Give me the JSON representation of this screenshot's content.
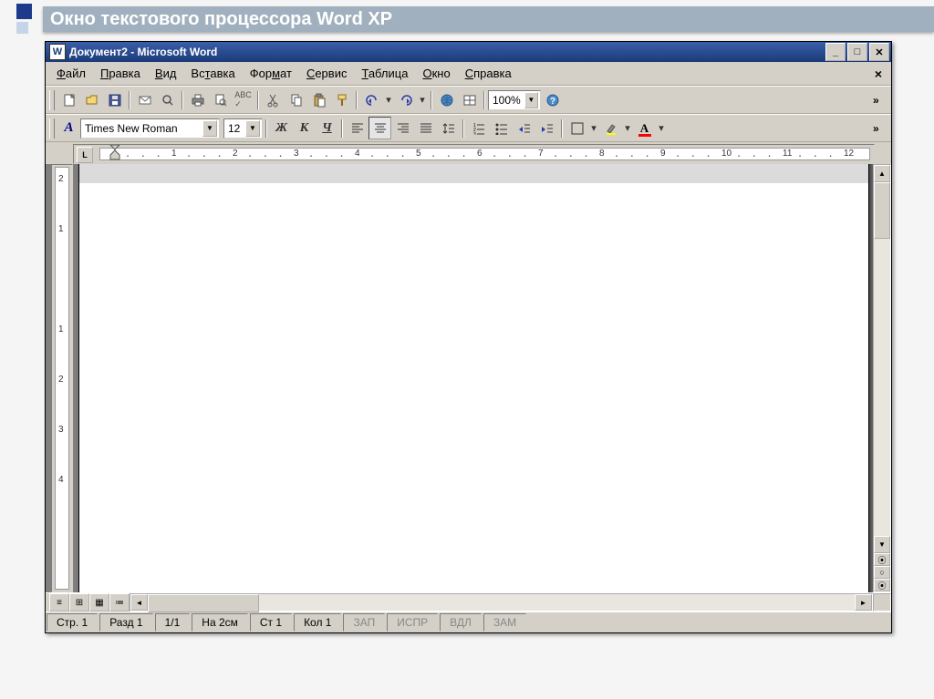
{
  "slide": {
    "title": "Окно текстового процессора Word XP"
  },
  "window": {
    "title": "Документ2 - Microsoft Word",
    "icon_letter": "W"
  },
  "menu": [
    "Файл",
    "Правка",
    "Вид",
    "Вставка",
    "Формат",
    "Сервис",
    "Таблица",
    "Окно",
    "Справка"
  ],
  "menu_underline_idx": [
    0,
    0,
    0,
    2,
    3,
    0,
    0,
    0,
    0
  ],
  "toolbar1": {
    "zoom": "100%"
  },
  "toolbar2": {
    "font": "Times New Roman",
    "size": "12",
    "bold": "Ж",
    "italic": "К",
    "underline": "Ч"
  },
  "ruler": {
    "nums": [
      1,
      2,
      3,
      4,
      5,
      6,
      7,
      8,
      9,
      10,
      11,
      12
    ],
    "tab_indicator": "L"
  },
  "vruler": {
    "nums": [
      2,
      1,
      1,
      2,
      3,
      4
    ]
  },
  "status": {
    "page": "Стр. 1",
    "section": "Разд 1",
    "pages": "1/1",
    "at": "На 2см",
    "line": "Ст 1",
    "col": "Кол 1",
    "rec": "ЗАП",
    "trk": "ИСПР",
    "ext": "ВДЛ",
    "ovr": "ЗАМ"
  }
}
